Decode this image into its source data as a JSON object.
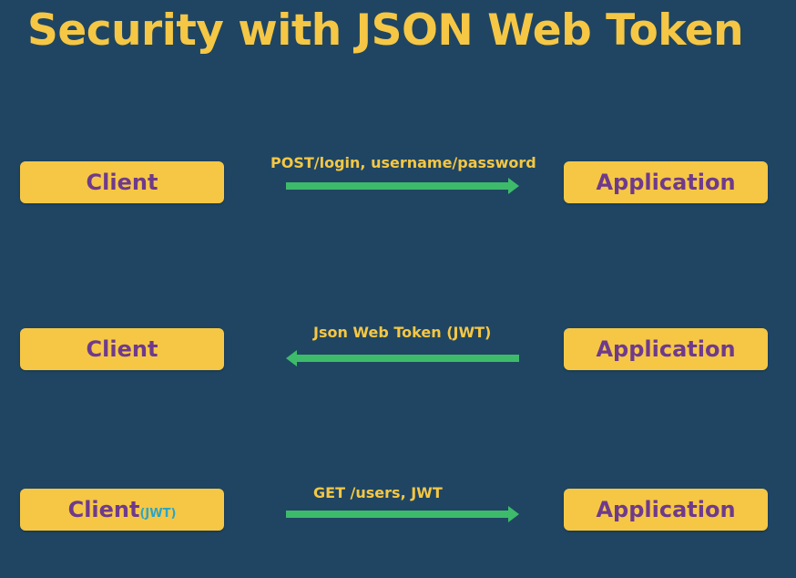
{
  "title": "Security with JSON Web Token",
  "rows": [
    {
      "client": "Client",
      "client_sub": "",
      "message": "POST/login, username/password",
      "direction": "right",
      "app": "Application"
    },
    {
      "client": "Client",
      "client_sub": "",
      "message": "Json Web Token (JWT)",
      "direction": "left",
      "app": "Application"
    },
    {
      "client": "Client",
      "client_sub": "(JWT)",
      "message": "GET /users, JWT",
      "direction": "right",
      "app": "Application"
    }
  ],
  "colors": {
    "background": "#1f4562",
    "title": "#f5c745",
    "box": "#f5c745",
    "box_text": "#6f3a8c",
    "arrow": "#3dbb6b",
    "sub_text": "#2aa5c9"
  }
}
